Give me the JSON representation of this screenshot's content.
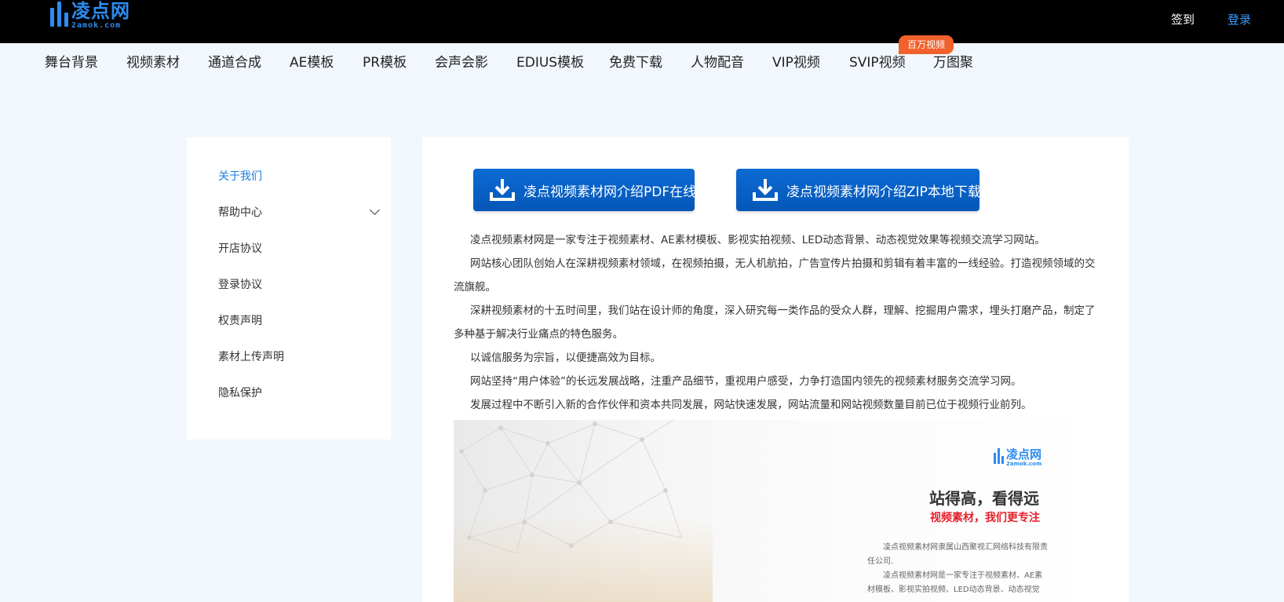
{
  "header": {
    "logo_cn": "凌点网",
    "logo_en": "2amok.com",
    "signin": "签到",
    "login": "登录"
  },
  "nav": {
    "items": [
      "舞台背景",
      "视频素材",
      "通道合成",
      "AE模板",
      "PR模板",
      "会声会影",
      "EDIUS模板",
      "免费下载",
      "人物配音",
      "VIP视频",
      "SVIP视频",
      "万图聚"
    ],
    "badge": "百万视频"
  },
  "sidebar": {
    "items": [
      "关于我们",
      "帮助中心",
      "开店协议",
      "登录协议",
      "权责声明",
      "素材上传声明",
      "隐私保护"
    ]
  },
  "buttons": {
    "pdf": "凌点视频素材网介绍PDF在线查看",
    "zip": "凌点视频素材网介绍ZIP本地下载"
  },
  "intro": [
    "凌点视频素材网是一家专注于视频素材、AE素材模板、影视实拍视频、LED动态背景、动态视觉效果等视频交流学习网站。",
    "网站核心团队创始人在深耕视频素材领域，在视频拍摄，无人机航拍，广告宣传片拍摄和剪辑有着丰富的一线经验。打造视频领域的交流旗舰。",
    "深耕视频素材的十五时间里，我们站在设计师的角度，深入研究每一类作品的受众人群，理解、挖掘用户需求，埋头打磨产品，制定了多种基于解决行业痛点的特色服务。",
    "以诚信服务为宗旨，以便捷高效为目标。",
    "网站坚持“用户体验”的长远发展战略，注重产品细节，重视用户感受，力争打造国内领先的视频素材服务交流学习网。",
    "发展过程中不断引入新的合作伙伴和资本共同发展，网站快速发展，网站流量和网站视频数量目前已位于视频行业前列。"
  ],
  "promo": {
    "logo_cn": "凌点网",
    "logo_en": "2amok.com",
    "slogan1": "站得高，看得远",
    "slogan2": "视频素材，我们更专注",
    "para1": "凌点视频素材网隶属山西聚视汇网络科技有限责任公司.",
    "para2": "凌点视频素材网是一家专注于视频素材、AE素材模板、影视实拍视频、LED动态背景、动态视觉"
  },
  "colors": {
    "accent": "#2d8cf0",
    "button": "#0c6ad3",
    "badge": "#f2602c",
    "slogan_red": "#e4202a"
  }
}
